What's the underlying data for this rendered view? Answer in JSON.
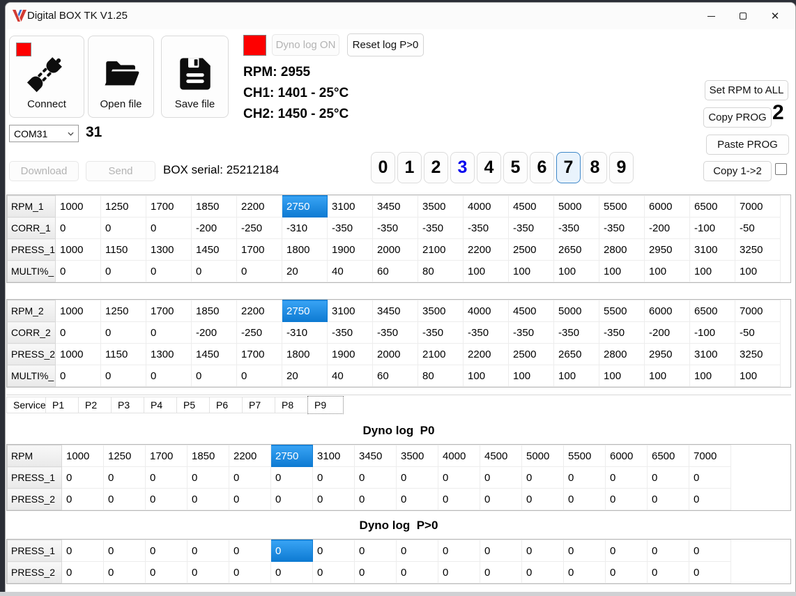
{
  "window": {
    "title": "Digital BOX TK V1.25"
  },
  "toolbar": {
    "connect_label": "Connect",
    "open_file_label": "Open file",
    "save_file_label": "Save file",
    "dyno_log_label": "Dyno log ON",
    "reset_log_label": "Reset log P>0",
    "com_port": "COM31",
    "com_number": "31",
    "download_label": "Download",
    "send_label": "Send",
    "box_serial": "BOX serial: 25212184"
  },
  "telemetry": {
    "rpm": "RPM: 2955",
    "ch1": "CH1: 1401 - 25°C",
    "ch2": "CH2: 1450 - 25°C"
  },
  "prog_selector": {
    "digits": [
      "0",
      "1",
      "2",
      "3",
      "4",
      "5",
      "6",
      "7",
      "8",
      "9"
    ],
    "blue_digit_index": 3,
    "selected_digit_index": 7
  },
  "right_panel": {
    "set_rpm_all_label": "Set RPM to ALL",
    "copy_prog_label": "Copy PROG",
    "copy_prog_count": "2",
    "paste_prog_label": "Paste PROG",
    "copy_12_label": "Copy 1->2"
  },
  "tabs": {
    "items": [
      "Service",
      "P1",
      "P2",
      "P3",
      "P4",
      "P5",
      "P6",
      "P7",
      "P8",
      "P9"
    ],
    "active": "P9"
  },
  "prog_table_1": {
    "rows": [
      {
        "label": "RPM_1",
        "selected": 5,
        "values": [
          1000,
          1250,
          1700,
          1850,
          2200,
          2750,
          3100,
          3450,
          3500,
          4000,
          4500,
          5000,
          5500,
          6000,
          6500,
          7000
        ]
      },
      {
        "label": "CORR_1",
        "values": [
          0,
          0,
          0,
          -200,
          -250,
          -310,
          -350,
          -350,
          -350,
          -350,
          -350,
          -350,
          -350,
          -200,
          -100,
          -50
        ]
      },
      {
        "label": "PRESS_1",
        "values": [
          1000,
          1150,
          1300,
          1450,
          1700,
          1800,
          1900,
          2000,
          2100,
          2200,
          2500,
          2650,
          2800,
          2950,
          3100,
          3250
        ]
      },
      {
        "label": "MULTI%_",
        "values": [
          0,
          0,
          0,
          0,
          0,
          20,
          40,
          60,
          80,
          100,
          100,
          100,
          100,
          100,
          100,
          100
        ]
      }
    ]
  },
  "prog_table_2": {
    "rows": [
      {
        "label": "RPM_2",
        "selected": 5,
        "values": [
          1000,
          1250,
          1700,
          1850,
          2200,
          2750,
          3100,
          3450,
          3500,
          4000,
          4500,
          5000,
          5500,
          6000,
          6500,
          7000
        ]
      },
      {
        "label": "CORR_2",
        "values": [
          0,
          0,
          0,
          -200,
          -250,
          -310,
          -350,
          -350,
          -350,
          -350,
          -350,
          -350,
          -350,
          -200,
          -100,
          -50
        ]
      },
      {
        "label": "PRESS_2",
        "values": [
          1000,
          1150,
          1300,
          1450,
          1700,
          1800,
          1900,
          2000,
          2100,
          2200,
          2500,
          2650,
          2800,
          2950,
          3100,
          3250
        ]
      },
      {
        "label": "MULTI%_",
        "values": [
          0,
          0,
          0,
          0,
          0,
          20,
          40,
          60,
          80,
          100,
          100,
          100,
          100,
          100,
          100,
          100
        ]
      }
    ]
  },
  "dyno_p0": {
    "title": "Dyno log  P0",
    "rows": [
      {
        "label": "RPM",
        "selected": 5,
        "values": [
          1000,
          1250,
          1700,
          1850,
          2200,
          2750,
          3100,
          3450,
          3500,
          4000,
          4500,
          5000,
          5500,
          6000,
          6500,
          7000
        ]
      },
      {
        "label": "PRESS_1",
        "values": [
          0,
          0,
          0,
          0,
          0,
          0,
          0,
          0,
          0,
          0,
          0,
          0,
          0,
          0,
          0,
          0
        ]
      },
      {
        "label": "PRESS_2",
        "values": [
          0,
          0,
          0,
          0,
          0,
          0,
          0,
          0,
          0,
          0,
          0,
          0,
          0,
          0,
          0,
          0
        ]
      }
    ]
  },
  "dyno_pg0": {
    "title": "Dyno log  P>0",
    "rows": [
      {
        "label": "PRESS_1",
        "selected": 5,
        "values": [
          0,
          0,
          0,
          0,
          0,
          0,
          0,
          0,
          0,
          0,
          0,
          0,
          0,
          0,
          0,
          0
        ]
      },
      {
        "label": "PRESS_2",
        "values": [
          0,
          0,
          0,
          0,
          0,
          0,
          0,
          0,
          0,
          0,
          0,
          0,
          0,
          0,
          0,
          0
        ]
      }
    ]
  },
  "colors": {
    "selection_blue": "#1284e8",
    "digit_blue": "#0000ee",
    "indicator_red": "#fe0000",
    "selected_prog_border": "#3d87c8"
  }
}
